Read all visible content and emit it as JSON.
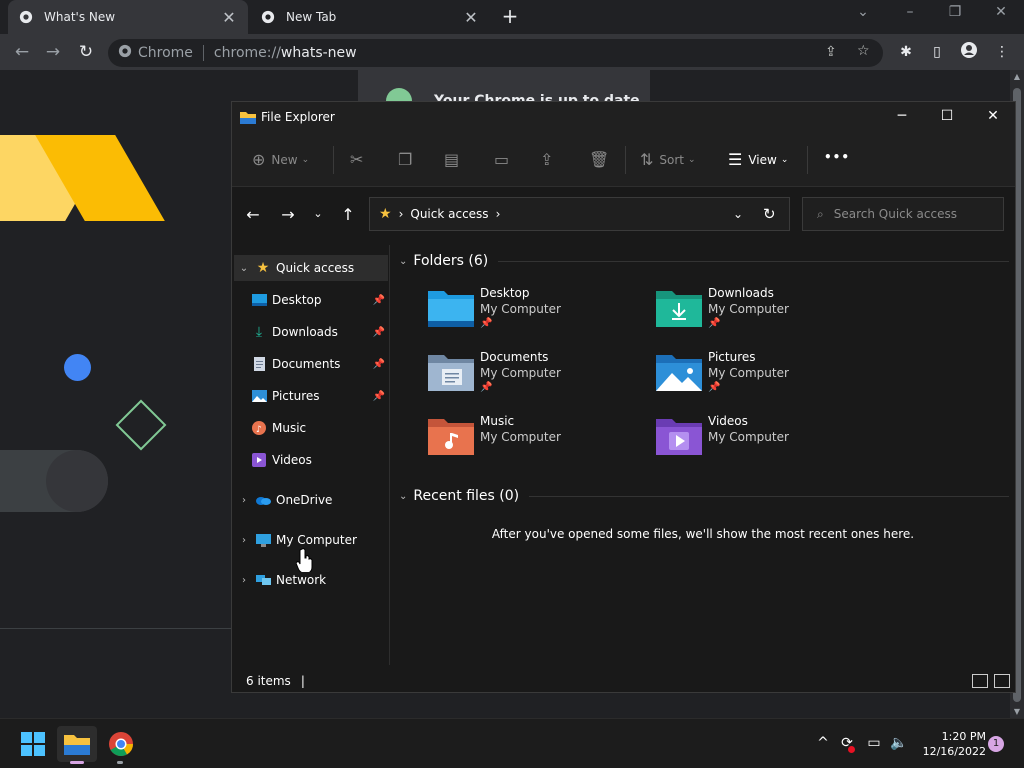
{
  "chrome": {
    "tabs": [
      {
        "title": "What's New",
        "active": true
      },
      {
        "title": "New Tab",
        "active": false
      }
    ],
    "new_tab_icon": "plus-icon",
    "omnibox": {
      "site_label": "Chrome",
      "url_scheme": "chrome://",
      "url_host": "whats-new"
    },
    "page_banner": "Your Chrome is up to date"
  },
  "explorer": {
    "title": "File Explorer",
    "commands": {
      "new_label": "New",
      "sort_label": "Sort",
      "view_label": "View",
      "more_label": "•••"
    },
    "address": {
      "root_label": "Quick access",
      "search_placeholder": "Search Quick access"
    },
    "nav": {
      "quick_access": "Quick access",
      "pinned": [
        {
          "label": "Desktop",
          "icon": "desktop-icon",
          "pinned": true
        },
        {
          "label": "Downloads",
          "icon": "downloads-icon",
          "pinned": true
        },
        {
          "label": "Documents",
          "icon": "documents-icon",
          "pinned": true
        },
        {
          "label": "Pictures",
          "icon": "pictures-icon",
          "pinned": true
        },
        {
          "label": "Music",
          "icon": "music-icon",
          "pinned": false
        },
        {
          "label": "Videos",
          "icon": "videos-icon",
          "pinned": false
        }
      ],
      "onedrive": "OneDrive",
      "my_computer": "My Computer",
      "network": "Network"
    },
    "folders_header": "Folders (6)",
    "folders": [
      {
        "name": "Desktop",
        "location": "My Computer",
        "pinned": true,
        "color": "#1e9be0"
      },
      {
        "name": "Downloads",
        "location": "My Computer",
        "pinned": true,
        "color": "#1fb89a"
      },
      {
        "name": "Documents",
        "location": "My Computer",
        "pinned": true,
        "color": "#8fa9c4"
      },
      {
        "name": "Pictures",
        "location": "My Computer",
        "pinned": true,
        "color": "#2d8fd8"
      },
      {
        "name": "Music",
        "location": "My Computer",
        "pinned": false,
        "color": "#e8734e"
      },
      {
        "name": "Videos",
        "location": "My Computer",
        "pinned": false,
        "color": "#8a55d4"
      }
    ],
    "recent_header": "Recent files (0)",
    "recent_empty": "After you've opened some files, we'll show the most recent ones here.",
    "status": "6 items"
  },
  "taskbar": {
    "time": "1:20 PM",
    "date": "12/16/2022",
    "notifications": "1"
  },
  "colors": {
    "folder_yellow": "#f7c23f",
    "accent_blue": "#4285f4"
  }
}
